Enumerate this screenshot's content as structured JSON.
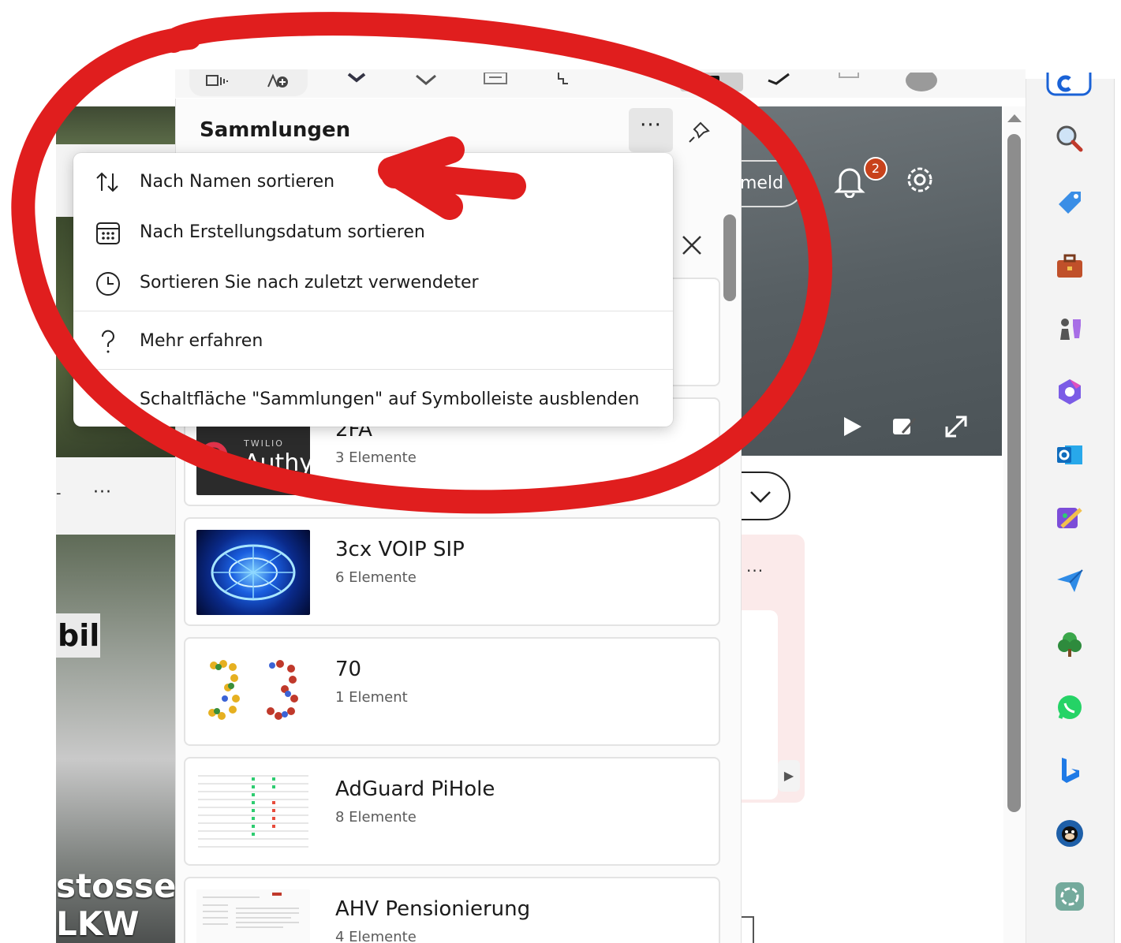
{
  "panel": {
    "title": "Sammlungen",
    "more_label": "···"
  },
  "menu": {
    "items": [
      {
        "label": "Nach Namen sortieren",
        "icon": "sort-arrows-icon"
      },
      {
        "label": "Nach Erstellungsdatum sortieren",
        "icon": "calendar-icon"
      },
      {
        "label": "Sortieren Sie nach zuletzt verwendeter",
        "icon": "clock-icon"
      },
      {
        "label": "Mehr erfahren",
        "icon": "question-icon"
      },
      {
        "label": "Schaltfläche \"Sammlungen\" auf Symbolleiste ausblenden",
        "icon": "none"
      }
    ]
  },
  "collections": [
    {
      "title": "2FA",
      "count": "3 Elemente",
      "thumb_brand": "TWILIO",
      "thumb_name": "Authy"
    },
    {
      "title": "3cx VOIP SIP",
      "count": "6 Elemente"
    },
    {
      "title": "70",
      "count": "1 Element"
    },
    {
      "title": "AdGuard PiHole",
      "count": "8 Elemente"
    },
    {
      "title": "AHV Pensionierung",
      "count": "4 Elemente"
    }
  ],
  "background": {
    "left_text_bil": "bil",
    "left_caption": "stosses\nLKW",
    "left_more": "···",
    "left_dash": "-",
    "signin_partial": "meld",
    "notification_count": "2",
    "right_more": "···"
  },
  "colors": {
    "annotation_red": "#e01e1e",
    "badge": "#c8421b",
    "accent": "#0f6cbd"
  }
}
